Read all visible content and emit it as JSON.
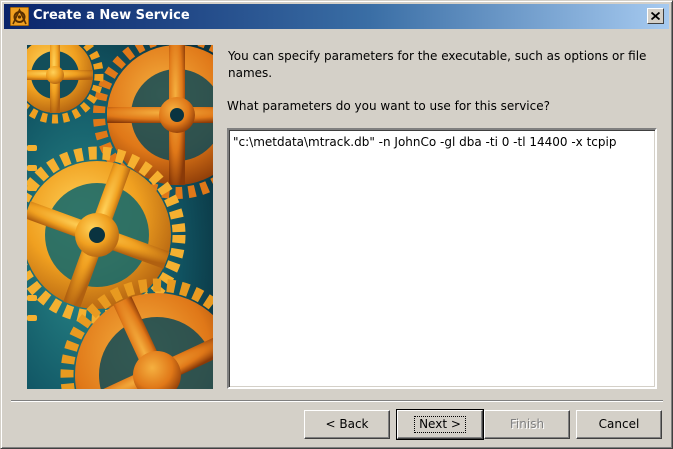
{
  "window": {
    "title": "Create a New Service",
    "title_icon": "service-wizard-icon",
    "close_icon": "close-icon",
    "colors": {
      "titlebar_start": "#0a246a",
      "titlebar_end": "#a6caf0",
      "face": "#d4d0c8"
    }
  },
  "page": {
    "intro_text": "You can specify parameters for the executable, such as options or file names.",
    "question_label": "What parameters do you want to use for this service?",
    "parameters_value": "\"c:\\metdata\\mtrack.db\" -n JohnCo -gl dba -ti 0 -tl 14400 -x tcpip"
  },
  "buttons": {
    "back": "< Back",
    "next": "Next >",
    "finish": "Finish",
    "cancel": "Cancel"
  },
  "illustration": "orange-gears-illustration"
}
